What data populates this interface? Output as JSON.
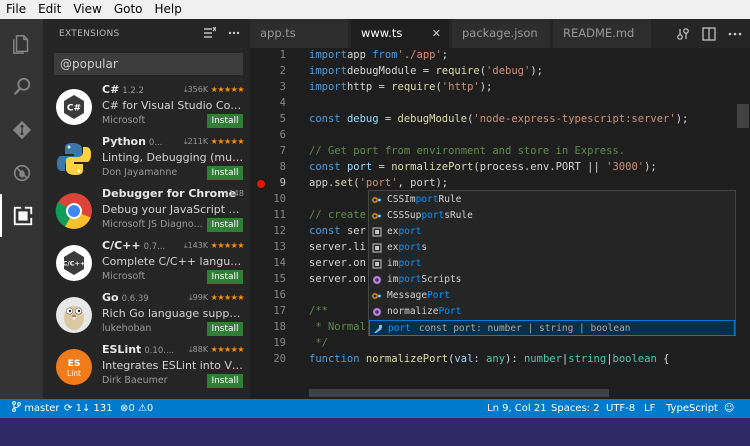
{
  "menu": [
    "File",
    "Edit",
    "View",
    "Goto",
    "Help"
  ],
  "sidebar": {
    "title": "EXTENSIONS",
    "search_value": "@popular",
    "install_label": "Install",
    "extensions": [
      {
        "name": "C#",
        "version": "1.2.2",
        "downloads": "356K",
        "stars": "★★★★★",
        "desc": "C# for Visual Studio Code (p...",
        "publisher": "Microsoft"
      },
      {
        "name": "Python",
        "version": "0...",
        "downloads": "211K",
        "stars": "★★★★★",
        "desc": "Linting, Debugging (multi-t...",
        "publisher": "Don Jayamanne"
      },
      {
        "name": "Debugger for Chrome",
        "version": "",
        "downloads": "148",
        "stars": "",
        "desc": "Debug your JavaScript code...",
        "publisher": "Microsoft JS Diagno..."
      },
      {
        "name": "C/C++",
        "version": "0.7...",
        "downloads": "143K",
        "stars": "★★★★★",
        "desc": "Complete C/C++ language ...",
        "publisher": "Microsoft"
      },
      {
        "name": "Go",
        "version": "0.6.39",
        "downloads": "99K",
        "stars": "★★★★★",
        "desc": "Rich Go language support f...",
        "publisher": "lukehoban"
      },
      {
        "name": "ESLint",
        "version": "0.10....",
        "downloads": "88K",
        "stars": "★★★★★",
        "desc": "Integrates ESLint into VS Co...",
        "publisher": "Dirk Baeumer"
      }
    ],
    "icon_labels": {
      "csharp": "C#",
      "cpp": "C/C++",
      "eslint_top": "ES",
      "eslint_bottom": "Lint"
    }
  },
  "tabs": [
    {
      "label": "app.ts",
      "active": false
    },
    {
      "label": "www.ts",
      "active": true
    },
    {
      "label": "package.json",
      "active": false
    },
    {
      "label": "README.md",
      "active": false
    }
  ],
  "editor": {
    "line_numbers": [
      "1",
      "2",
      "3",
      "4",
      "5",
      "6",
      "7",
      "8",
      "9",
      "10",
      "11",
      "12",
      "13",
      "14",
      "15",
      "16",
      "17",
      "18",
      "19",
      "20"
    ],
    "current_line": "9"
  },
  "suggest": [
    {
      "pre": "CSSIm",
      "match": "port",
      "post": "Rule",
      "icon": "class",
      "detail": ""
    },
    {
      "pre": "CSSSup",
      "match": "port",
      "post": "sRule",
      "icon": "class",
      "detail": ""
    },
    {
      "pre": "ex",
      "match": "port",
      "post": "",
      "icon": "module",
      "detail": ""
    },
    {
      "pre": "ex",
      "match": "port",
      "post": "s",
      "icon": "module",
      "detail": ""
    },
    {
      "pre": "im",
      "match": "port",
      "post": "",
      "icon": "module",
      "detail": ""
    },
    {
      "pre": "im",
      "match": "port",
      "post": "Scripts",
      "icon": "method",
      "detail": ""
    },
    {
      "pre": "Message",
      "match": "Port",
      "post": "",
      "icon": "class",
      "detail": ""
    },
    {
      "pre": "normalize",
      "match": "Port",
      "post": "",
      "icon": "method",
      "detail": ""
    },
    {
      "pre": "",
      "match": "port",
      "post": "",
      "icon": "variable",
      "detail": "const port: number | string | boolean"
    }
  ],
  "status": {
    "branch": "master",
    "sync": "1↓ 131",
    "errors": "0",
    "warnings": "0",
    "position": "Ln 9, Col 21",
    "spaces": "Spaces: 2",
    "encoding": "UTF-8",
    "eol": "LF",
    "language": "TypeScript"
  },
  "colors": {
    "accent": "#007acc",
    "install": "#327e36",
    "star": "#ff8e00"
  }
}
